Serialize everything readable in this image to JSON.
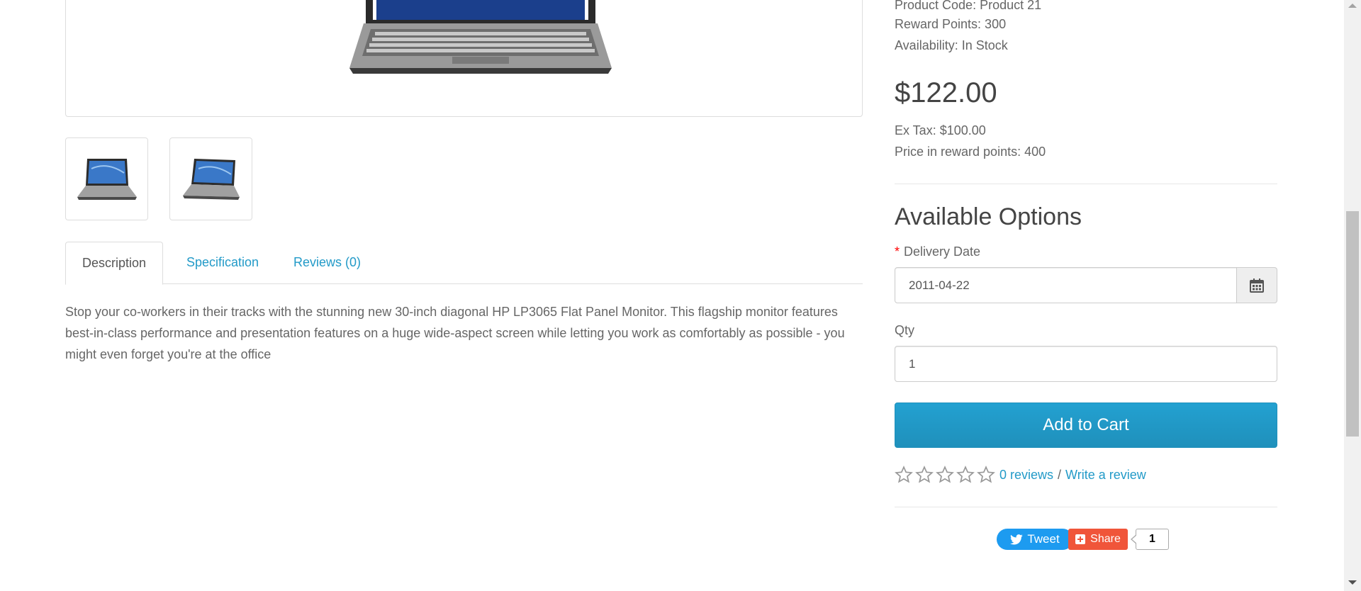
{
  "product": {
    "code_line": "Product Code: Product 21",
    "reward_points_line": "Reward Points: 300",
    "availability_line": "Availability: In Stock",
    "price": "$122.00",
    "ex_tax_line": "Ex Tax: $100.00",
    "reward_price_line": "Price in reward points: 400"
  },
  "tabs": [
    {
      "label": "Description",
      "active": true
    },
    {
      "label": "Specification",
      "active": false
    },
    {
      "label": "Reviews (0)",
      "active": false
    }
  ],
  "description": "Stop your co-workers in their tracks with the stunning new 30-inch diagonal HP LP3065 Flat Panel Monitor. This flagship monitor features best-in-class performance and presentation features on a huge wide-aspect screen while letting you work as comfortably as possible - you might even forget you're at the office",
  "options": {
    "title": "Available Options",
    "required_marker": "*",
    "delivery_date_label": "Delivery Date",
    "delivery_date_value": "2011-04-22",
    "qty_label": "Qty",
    "qty_value": "1"
  },
  "cart": {
    "button_label": "Add to Cart"
  },
  "reviews": {
    "rating_stars": 0,
    "max_stars": 5,
    "count_link": "0 reviews",
    "separator": "/",
    "write_link": "Write a review"
  },
  "social": {
    "tweet_label": "Tweet",
    "share_label": "Share",
    "share_count": "1"
  },
  "colors": {
    "accent": "#229ac8",
    "cart_button": "#229ac8",
    "required": "#ff0000",
    "tweet": "#1d9bf0",
    "share": "#f0553a"
  },
  "icons": {
    "calendar": "calendar-icon",
    "star": "star-outline-icon",
    "twitter": "twitter-bird-icon",
    "share": "plus-square-icon"
  }
}
